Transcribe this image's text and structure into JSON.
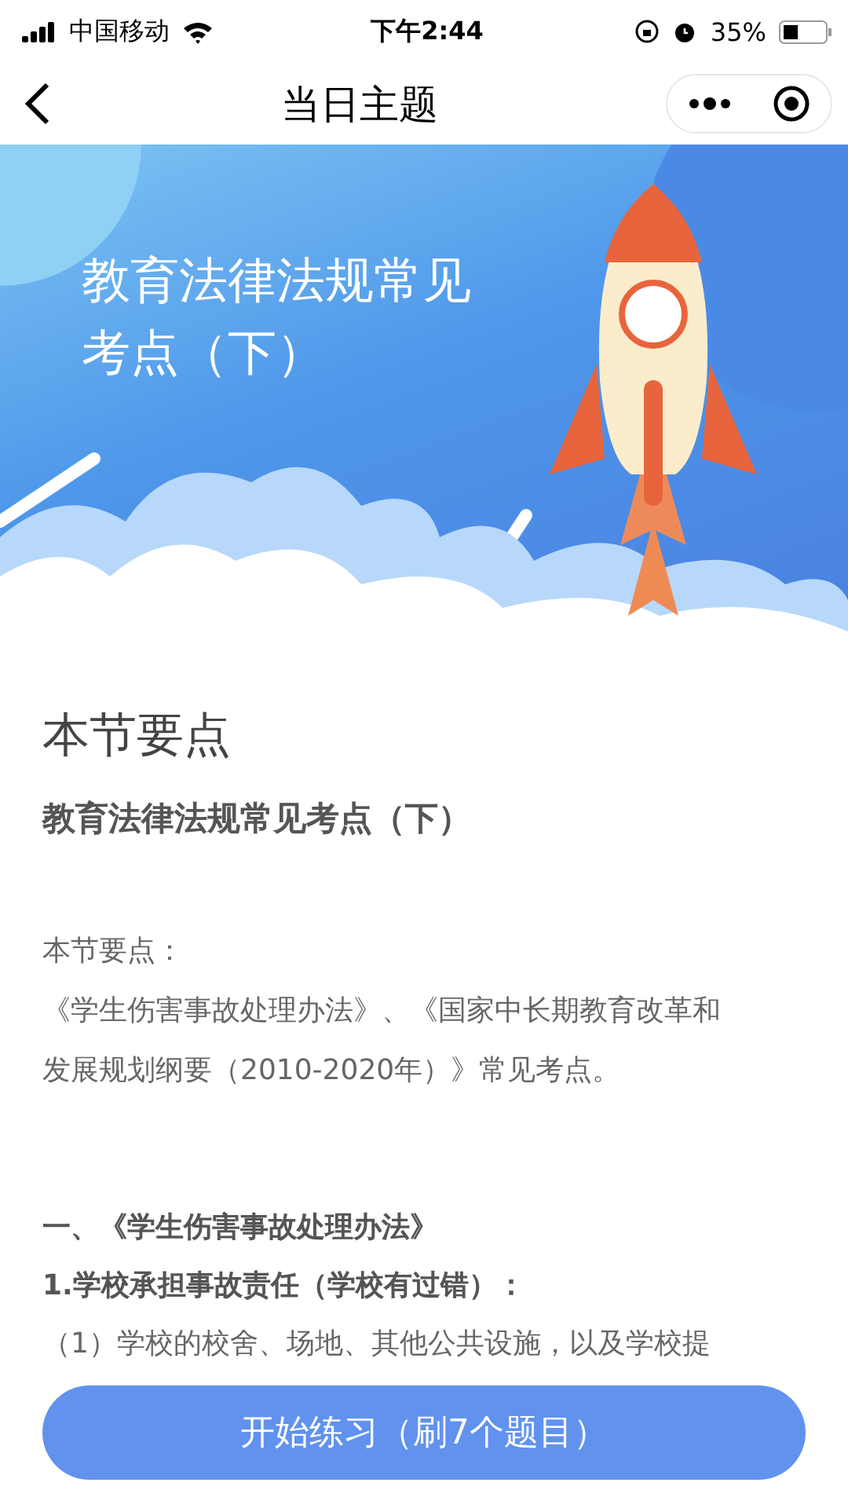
{
  "status_bar": {
    "carrier": "中国移动",
    "time": "下午2:44",
    "battery_text": "35%"
  },
  "nav": {
    "title": "当日主题"
  },
  "hero": {
    "title_lines": [
      "教育法律法规常见",
      "考点（下）"
    ]
  },
  "content": {
    "heading": "本节要点",
    "subtitle": "教育法律法规常见考点（下）",
    "intro_label": "本节要点：",
    "intro_lines": [
      "《学生伤害事故处理办法》、《国家中长期教育改革和",
      "发展规划纲要（2010-2020年）》常见考点。"
    ],
    "section_title": "一、《学生伤害事故处理办法》",
    "point_title": "1.学校承担事故责任（学校有过错）：",
    "point_lines": [
      "（1）学校的校舍、场地、其他公共设施，以及学校提"
    ]
  },
  "start_button": {
    "label": "开始练习（刷7个题目）"
  }
}
